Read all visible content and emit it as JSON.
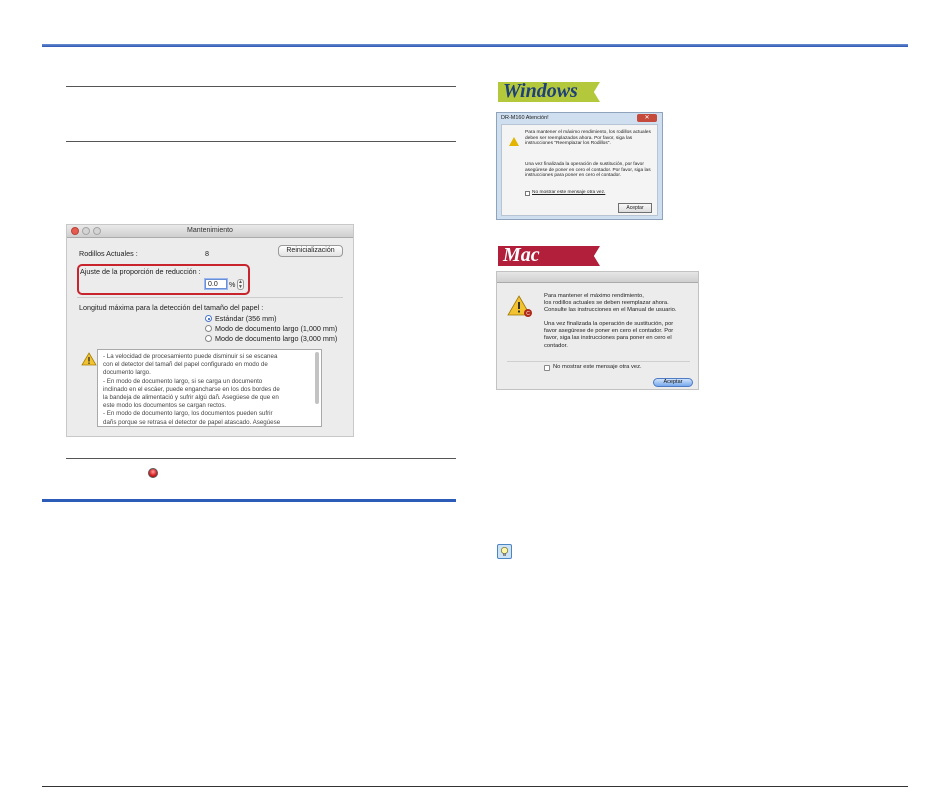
{
  "maintenance_dialog": {
    "title": "Mantenimiento",
    "current_rollers_label": "Rodillos Actuales :",
    "current_rollers_value": "8",
    "reset_button": "Reinicialización",
    "reduction_label": "Ajuste de la proporción de reducción :",
    "reduction_value": "0.0",
    "reduction_unit": "%",
    "max_length_label": "Longitud máxima para la detección del tamaño del papel :",
    "options": [
      {
        "label": "Estándar (356 mm)",
        "selected": true
      },
      {
        "label": "Modo de documento largo (1,000 mm)",
        "selected": false
      },
      {
        "label": "Modo de documento largo (3,000 mm)",
        "selected": false
      }
    ],
    "warning_text": "- La velocidad de procesamiento puede disminuir si se escanea\ncon el detector del tamañ del papel configurado en modo de\ndocumento largo.\n- En modo de documento largo, si se carga un documento\ninclinado en el escáer, puede engancharse en los dos bordes de\nla bandeja de alimentació y sufrir algú dañ. Asegúese de que en\neste modo los documentos se cargan rectos.\n- En modo de documento largo, los documentos pueden sufrir\ndañs porque se retrasa el detector de papel atascado. Asegúese"
  },
  "windows_badge": "Windows",
  "windows_dialog": {
    "title": "DR-M160 Atención!",
    "close": "✕",
    "text1": "Para mantener el máximo rendimiento, los rodillos actuales\ndeben ser reemplazados ahora. Por favor, siga las\ninstrucciones \"Reemplazar los Rodillos\".",
    "text2": "Una vez finalizada la operación de sustitución, por favor\nasegúrese de poner en cero el contador. Por favor, siga las\ninstrucciones para poner en cero el contador.",
    "checkbox": "No mostrar este mensaje otra vez.",
    "button": "Aceptar"
  },
  "mac_badge": "Mac",
  "mac_alert": {
    "text1": "Para mantener el máximo rendimiento,\nlos rodillos actuales se deben reemplazar ahora.\nConsulte las instrucciones en el Manual de usuario.",
    "text2": "Una vez finalizada la operación de sustitución, por\nfavor asegúrese de poner en cero el contador. Por\nfavor, siga las instrucciones para poner en cero el\ncontador.",
    "checkbox": "No mostrar este mensaje otra vez.",
    "button": "Aceptar"
  },
  "colors": {
    "accent_blue": "#2c5bb8",
    "highlight_red": "#c8242d",
    "windows_badge": "#b3c83a",
    "mac_badge": "#b11f3a"
  }
}
